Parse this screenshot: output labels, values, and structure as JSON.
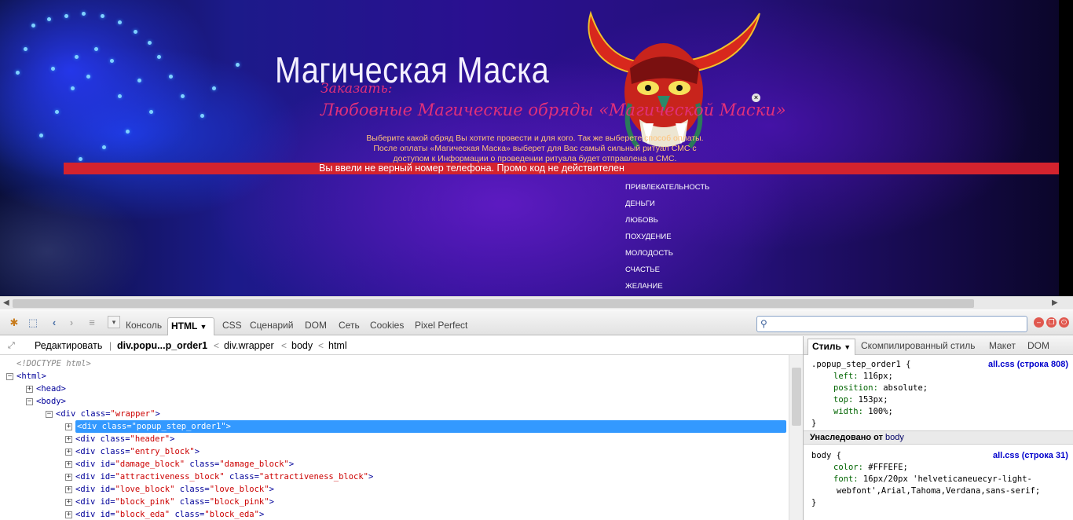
{
  "site": {
    "title": "Магическая Маска",
    "order_label": "Заказать:",
    "ritual_title": "Любовные Магические обряды «Магической Маски»",
    "intro_text": "Выберите какой обряд Вы хотите провести и для кого. Так же выберете способ оплаты. После оплаты «Магическая Маска» выберет для Вас самый сильный ритуал СМС с доступом к Информации о проведении ритуала будет отправлена в СМС.",
    "error_message": "Вы ввели не верный номер телефона. Промо код не действителен",
    "menu": [
      "ПРИВЛЕКАТЕЛЬНОСТЬ",
      "ДЕНЬГИ",
      "ЛЮБОВЬ",
      "ПОХУДЕНИЕ",
      "МОЛОДОСТЬ",
      "СЧАСТЬЕ",
      "ЖЕЛАНИЕ"
    ],
    "close_icon": "×",
    "colors": {
      "error_bar": "#d3232e",
      "pink_text": "#e0307a",
      "intro_text": "#ffc27a"
    }
  },
  "firebug": {
    "tabs": [
      "Консоль",
      "HTML",
      "CSS",
      "Сценарий",
      "DOM",
      "Сеть",
      "Cookies",
      "Pixel Perfect"
    ],
    "active_tab": "HTML",
    "search_placeholder": "",
    "breadcrumb": {
      "edit": "Редактировать",
      "items": [
        "div.popu...p_order1",
        "div.wrapper",
        "body",
        "html"
      ]
    },
    "side_tabs": [
      "Стиль",
      "Скомпилированный стиль",
      "Макет",
      "DOM"
    ],
    "icons": [
      "inspect-icon",
      "pointer-icon",
      "back-icon",
      "forward-icon",
      "list-icon",
      "dropdown-icon",
      "search-icon",
      "minimize-icon",
      "detach-icon",
      "close-icon"
    ]
  },
  "tree": [
    {
      "indent": 0,
      "expander": "",
      "parts": [
        {
          "c": "tc",
          "t": "<!DOCTYPE html>"
        }
      ]
    },
    {
      "indent": 0,
      "expander": "−",
      "parts": [
        {
          "c": "tg",
          "t": "<html>"
        }
      ]
    },
    {
      "indent": 1,
      "expander": "+",
      "parts": [
        {
          "c": "tg",
          "t": "<head>"
        }
      ]
    },
    {
      "indent": 1,
      "expander": "−",
      "parts": [
        {
          "c": "tg",
          "t": "<body>"
        }
      ]
    },
    {
      "indent": 2,
      "expander": "−",
      "parts": [
        {
          "c": "tg",
          "t": "<div "
        },
        {
          "c": "ta",
          "t": "class="
        },
        {
          "c": "tv",
          "t": "\"wrapper\""
        },
        {
          "c": "tg",
          "t": ">"
        }
      ]
    },
    {
      "indent": 3,
      "expander": "+",
      "selected": true,
      "parts": [
        {
          "c": "tg",
          "t": "<div "
        },
        {
          "c": "ta",
          "t": "class="
        },
        {
          "c": "tv",
          "t": "\"popup_step_order1\""
        },
        {
          "c": "tg",
          "t": ">"
        }
      ]
    },
    {
      "indent": 3,
      "expander": "+",
      "parts": [
        {
          "c": "tg",
          "t": "<div "
        },
        {
          "c": "ta",
          "t": "class="
        },
        {
          "c": "tv",
          "t": "\"header\""
        },
        {
          "c": "tg",
          "t": ">"
        }
      ]
    },
    {
      "indent": 3,
      "expander": "+",
      "parts": [
        {
          "c": "tg",
          "t": "<div "
        },
        {
          "c": "ta",
          "t": "class="
        },
        {
          "c": "tv",
          "t": "\"entry_block\""
        },
        {
          "c": "tg",
          "t": ">"
        }
      ]
    },
    {
      "indent": 3,
      "expander": "+",
      "parts": [
        {
          "c": "tg",
          "t": "<div "
        },
        {
          "c": "ta",
          "t": "id="
        },
        {
          "c": "tv",
          "t": "\"damage_block\""
        },
        {
          "c": "ta",
          "t": " class="
        },
        {
          "c": "tv",
          "t": "\"damage_block\""
        },
        {
          "c": "tg",
          "t": ">"
        }
      ]
    },
    {
      "indent": 3,
      "expander": "+",
      "parts": [
        {
          "c": "tg",
          "t": "<div "
        },
        {
          "c": "ta",
          "t": "id="
        },
        {
          "c": "tv",
          "t": "\"attractiveness_block\""
        },
        {
          "c": "ta",
          "t": " class="
        },
        {
          "c": "tv",
          "t": "\"attractiveness_block\""
        },
        {
          "c": "tg",
          "t": ">"
        }
      ]
    },
    {
      "indent": 3,
      "expander": "+",
      "parts": [
        {
          "c": "tg",
          "t": "<div "
        },
        {
          "c": "ta",
          "t": "id="
        },
        {
          "c": "tv",
          "t": "\"love_block\""
        },
        {
          "c": "ta",
          "t": " class="
        },
        {
          "c": "tv",
          "t": "\"love_block\""
        },
        {
          "c": "tg",
          "t": ">"
        }
      ]
    },
    {
      "indent": 3,
      "expander": "+",
      "parts": [
        {
          "c": "tg",
          "t": "<div "
        },
        {
          "c": "ta",
          "t": "id="
        },
        {
          "c": "tv",
          "t": "\"block_pink\""
        },
        {
          "c": "ta",
          "t": " class="
        },
        {
          "c": "tv",
          "t": "\"block_pink\""
        },
        {
          "c": "tg",
          "t": ">"
        }
      ]
    },
    {
      "indent": 3,
      "expander": "+",
      "parts": [
        {
          "c": "tg",
          "t": "<div "
        },
        {
          "c": "ta",
          "t": "id="
        },
        {
          "c": "tv",
          "t": "\"block_eda\""
        },
        {
          "c": "ta",
          "t": " class="
        },
        {
          "c": "tv",
          "t": "\"block_eda\""
        },
        {
          "c": "tg",
          "t": ">"
        }
      ]
    }
  ],
  "styles": {
    "rule1": {
      "selector": ".popup_step_order1 {",
      "source": "all.css (строка 808)",
      "props": [
        {
          "name": "left:",
          "value": " 116px;"
        },
        {
          "name": "position:",
          "value": " absolute;"
        },
        {
          "name": "top:",
          "value": " 153px;"
        },
        {
          "name": "width:",
          "value": " 100%;"
        }
      ],
      "close": "}"
    },
    "inherited_label": "Унаследовано от",
    "inherited_from": "body",
    "rule2": {
      "selector": "body {",
      "source": "all.css (строка 31)",
      "props": [
        {
          "name": "color:",
          "value": " #FFFEFE;"
        },
        {
          "name": "font:",
          "value": " 16px/20px 'helveticaneuecyr-light-"
        }
      ],
      "font_cont": "webfont',Arial,Tahoma,Verdana,sans-serif;",
      "close": "}"
    }
  }
}
